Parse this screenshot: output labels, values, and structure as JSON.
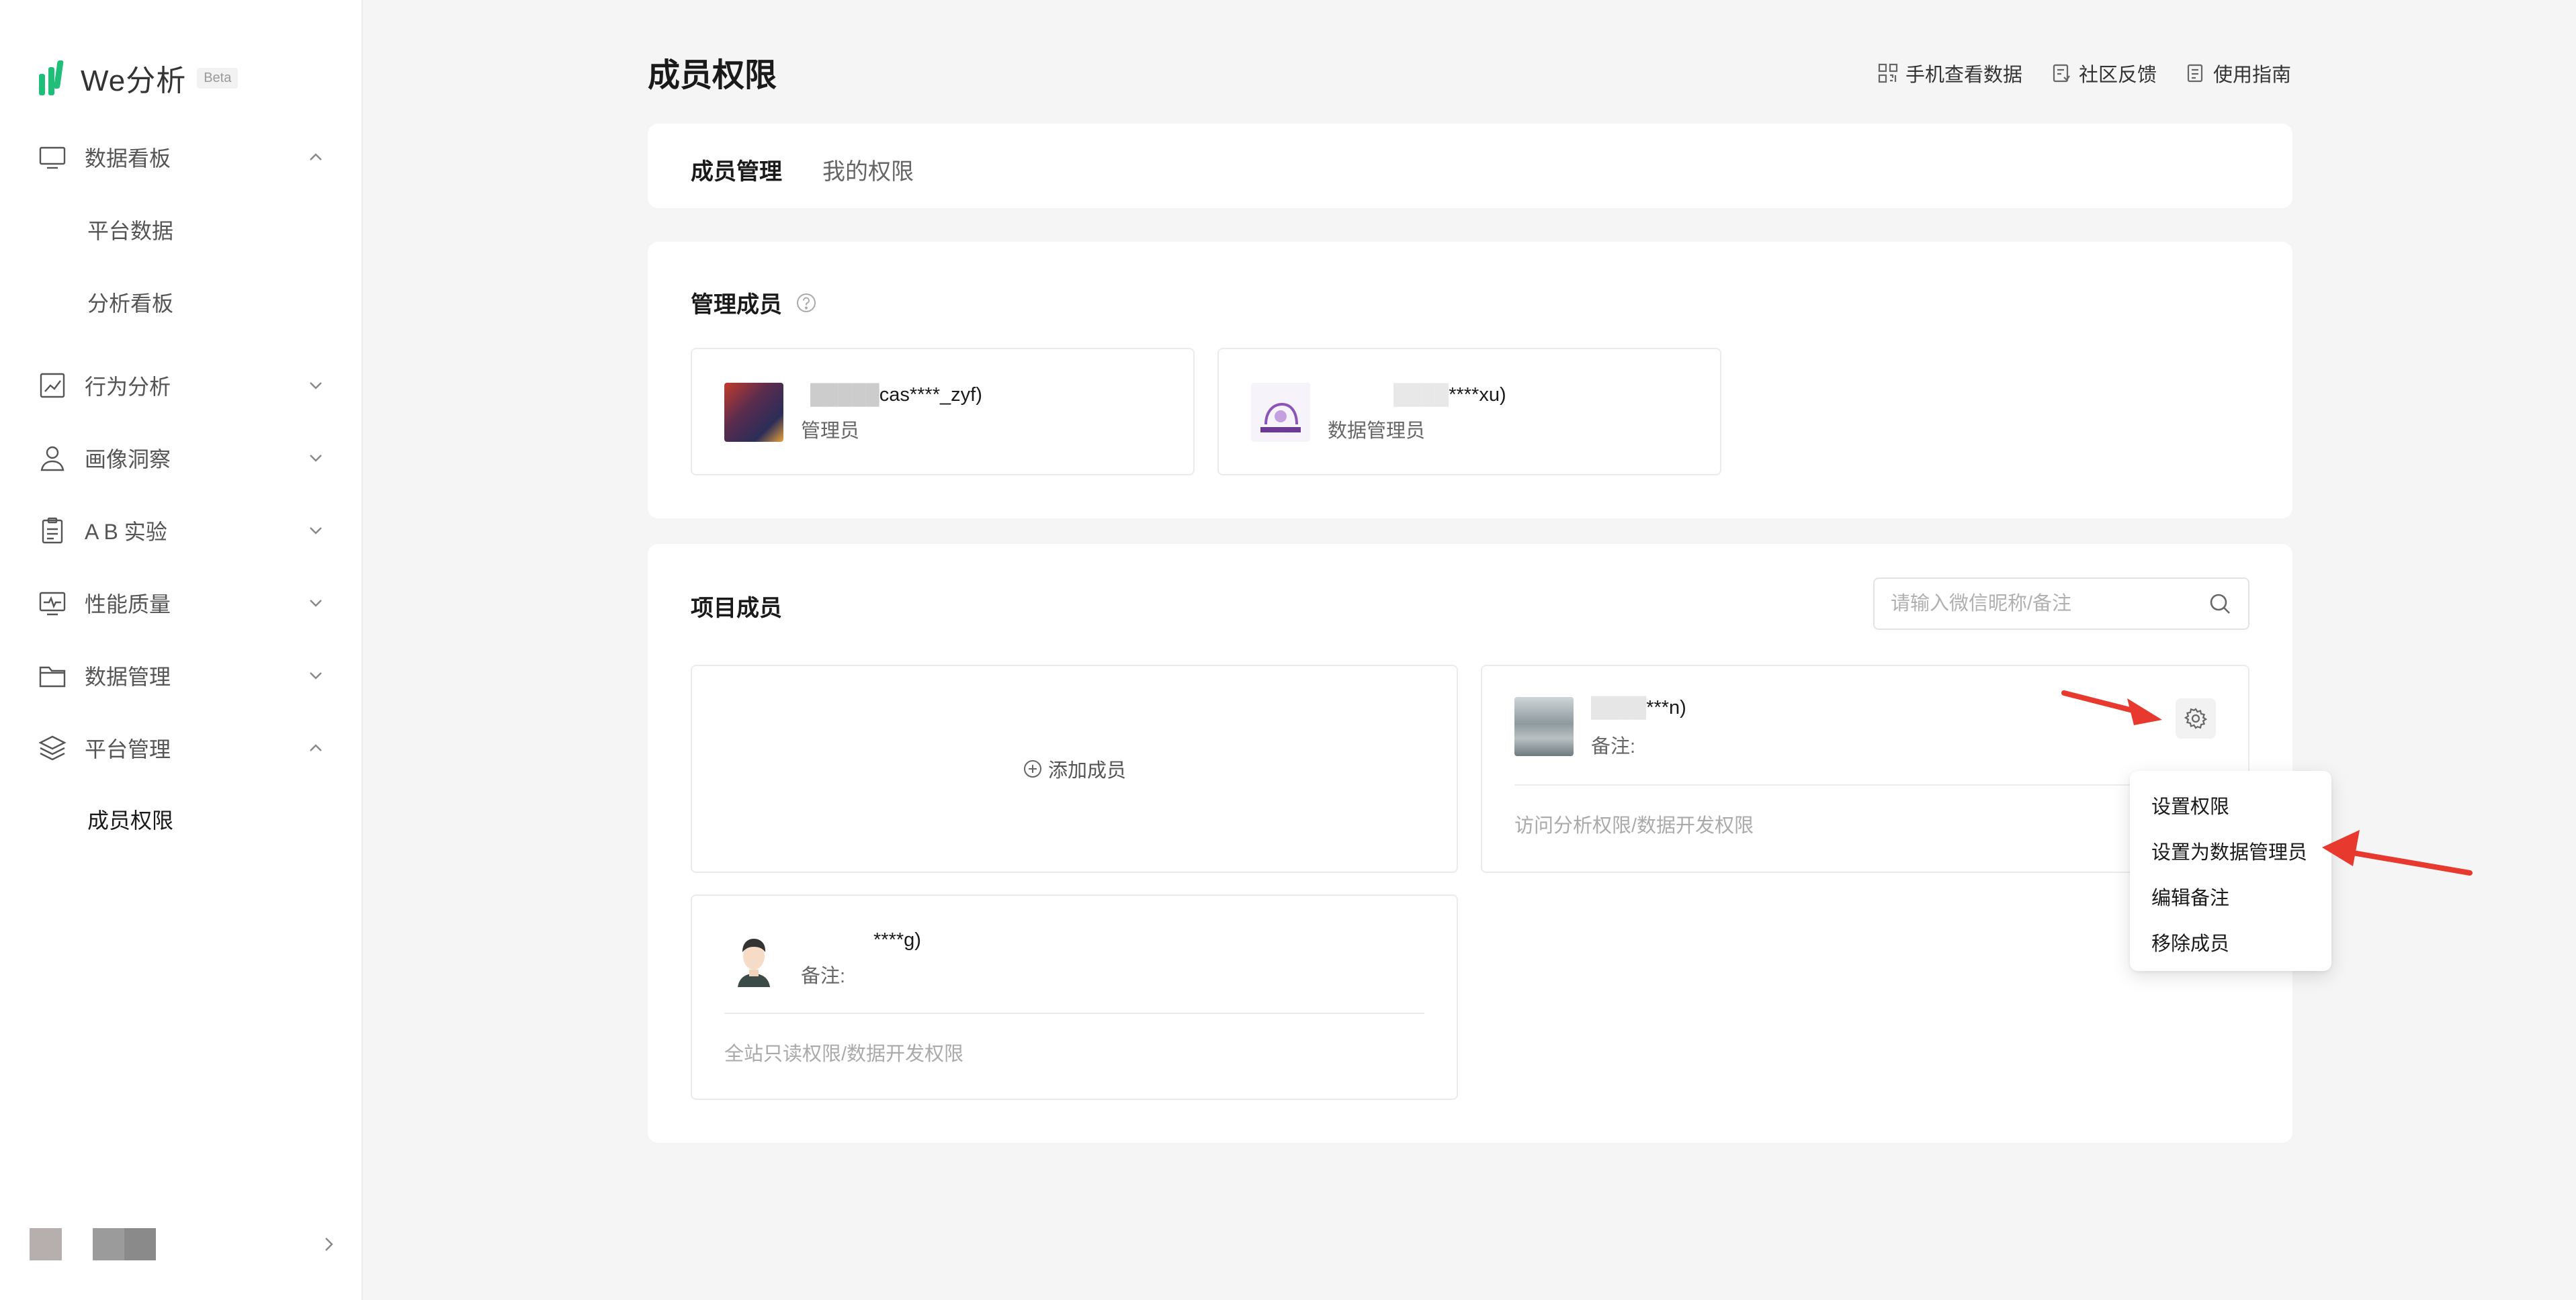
{
  "app": {
    "logo_text": "We分析",
    "beta_label": "Beta"
  },
  "sidebar": {
    "items": [
      {
        "label": "数据看板",
        "icon": "monitor-icon",
        "expanded": true
      },
      {
        "label": "行为分析",
        "icon": "line-chart-icon",
        "expanded": false
      },
      {
        "label": "画像洞察",
        "icon": "user-profile-icon",
        "expanded": false
      },
      {
        "label": "A B 实验",
        "icon": "clipboard-icon",
        "expanded": false
      },
      {
        "label": "性能质量",
        "icon": "performance-monitor-icon",
        "expanded": false
      },
      {
        "label": "数据管理",
        "icon": "folder-icon",
        "expanded": false
      },
      {
        "label": "平台管理",
        "icon": "layers-icon",
        "expanded": true
      }
    ],
    "sub_items": {
      "dashboard": [
        "平台数据",
        "分析看板"
      ],
      "platform": [
        "成员权限"
      ]
    }
  },
  "header": {
    "title": "成员权限",
    "links": [
      {
        "label": "手机查看数据",
        "icon": "qrcode-icon"
      },
      {
        "label": "社区反馈",
        "icon": "feedback-icon"
      },
      {
        "label": "使用指南",
        "icon": "guide-icon"
      }
    ]
  },
  "tabs": [
    {
      "label": "成员管理",
      "active": true
    },
    {
      "label": "我的权限",
      "active": false
    }
  ],
  "admins": {
    "title": "管理成员",
    "members": [
      {
        "name": "cas****_zyf)",
        "role": "管理员"
      },
      {
        "name": "****xu)",
        "role": "数据管理员"
      }
    ]
  },
  "project": {
    "title": "项目成员",
    "search_placeholder": "请输入微信昵称/备注",
    "add_label": "添加成员",
    "members": [
      {
        "name": "***n)",
        "note_label": "备注:",
        "permissions": "访问分析权限/数据开发权限"
      },
      {
        "name": "****g)",
        "note_label": "备注:",
        "permissions": "全站只读权限/数据开发权限"
      }
    ]
  },
  "dropdown": {
    "items": [
      "设置权限",
      "设置为数据管理员",
      "编辑备注",
      "移除成员"
    ]
  },
  "colors": {
    "accent_green": "#1fbf7a",
    "annotation_red": "#e8392e",
    "text_primary": "#1a1a1a",
    "text_muted": "#aaaaaa"
  }
}
